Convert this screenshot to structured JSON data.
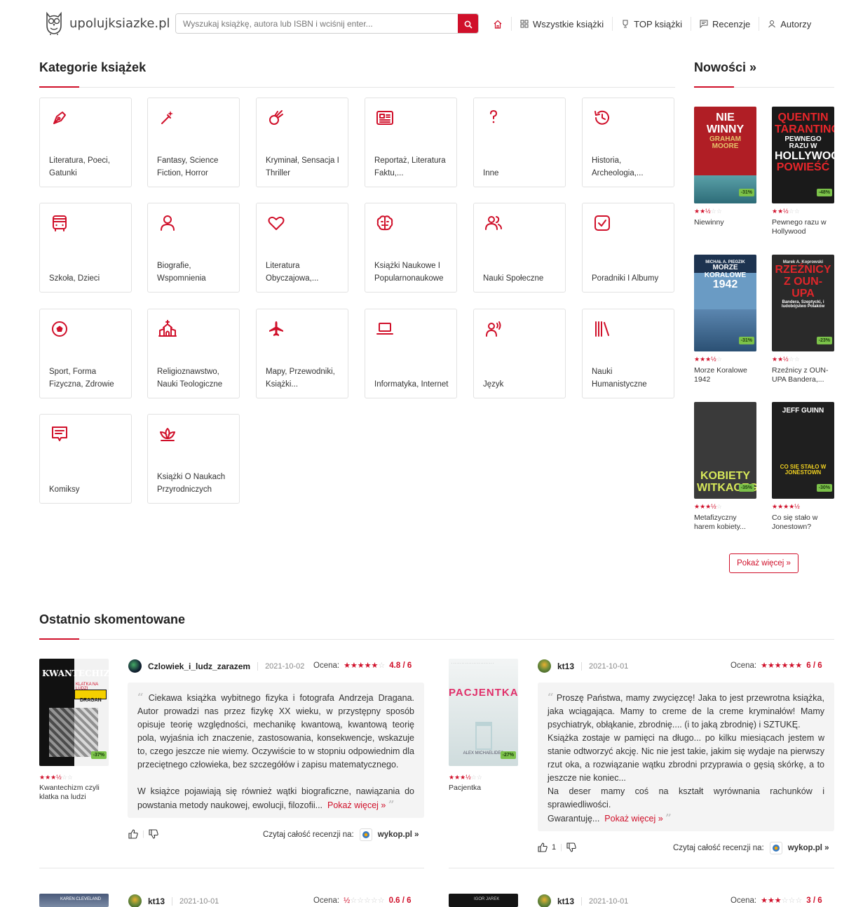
{
  "header": {
    "logo": "upolujksiazke.pl",
    "search_placeholder": "Wyszukaj książkę, autora lub ISBN i wciśnij enter...",
    "nav": [
      "Wszystkie książki",
      "TOP książki",
      "Recenzje",
      "Autorzy"
    ]
  },
  "categories_section": {
    "title": "Kategorie książek",
    "items": [
      {
        "label": "Literatura, Poeci, Gatunki",
        "icon": "pen-nib-icon"
      },
      {
        "label": "Fantasy, Science Fiction, Horror",
        "icon": "magic-wand-icon"
      },
      {
        "label": "Kryminał, Sensacja I Thriller",
        "icon": "comet-icon"
      },
      {
        "label": "Reportaż, Literatura Faktu,...",
        "icon": "newspaper-icon"
      },
      {
        "label": "Inne",
        "icon": "question-icon"
      },
      {
        "label": "Historia, Archeologia,...",
        "icon": "history-icon"
      },
      {
        "label": "Szkoła, Dzieci",
        "icon": "bus-icon"
      },
      {
        "label": "Biografie, Wspomnienia",
        "icon": "person-icon"
      },
      {
        "label": "Literatura Obyczajowa,...",
        "icon": "heart-icon"
      },
      {
        "label": "Książki Naukowe I Popularnonaukowe",
        "icon": "brain-icon"
      },
      {
        "label": "Nauki Społeczne",
        "icon": "people-icon"
      },
      {
        "label": "Poradniki I Albumy",
        "icon": "checkbox-icon"
      },
      {
        "label": "Sport, Forma Fizyczna, Zdrowie",
        "icon": "ball-icon"
      },
      {
        "label": "Religioznawstwo, Nauki Teologiczne",
        "icon": "church-icon"
      },
      {
        "label": "Mapy, Przewodniki, Książki...",
        "icon": "plane-icon"
      },
      {
        "label": "Informatyka, Internet",
        "icon": "laptop-icon"
      },
      {
        "label": "Język",
        "icon": "speaking-icon"
      },
      {
        "label": "Nauki Humanistyczne",
        "icon": "books-icon"
      },
      {
        "label": "Komiksy",
        "icon": "speech-bubble-icon"
      },
      {
        "label": "Książki O Naukach Przyrodniczych",
        "icon": "lotus-icon"
      }
    ]
  },
  "new_books": {
    "title": "Nowości »",
    "more": "Pokaż więcej »",
    "items": [
      {
        "title": "Niewinny",
        "discount": "-31%",
        "stars": 2,
        "cover_text": [
          "NIE",
          "WINNY",
          "GRAHAM MOORE"
        ],
        "color": "#b01e25"
      },
      {
        "title": "Pewnego razu w Hollywood",
        "discount": "-48%",
        "stars": 2,
        "cover_text": [
          "QUENTIN",
          "TARANTINO",
          "PEWNEGO RAZU W",
          "HOLLYWOOD",
          "POWIEŚĆ"
        ],
        "color": "#1a1a1a"
      },
      {
        "title": "Morze Koralowe 1942",
        "discount": "-31%",
        "stars": 3,
        "cover_text": [
          "MICHAŁ A. PIEGZIK",
          "MORZE KORALOWE",
          "1942"
        ],
        "color": "#6a9bc4"
      },
      {
        "title": "Rzeźnicy z OUN-UPA Bandera,...",
        "discount": "-23%",
        "stars": 2,
        "cover_text": [
          "Marek A. Koprowski",
          "RZEŹNICY",
          "Z OUN-UPA",
          "Bandera, Szeptycki, i ludobójstwo Polaków"
        ],
        "color": "#2a2a2a"
      },
      {
        "title": "Metafizyczny harem kobiety...",
        "discount": "-35%",
        "stars": 3,
        "cover_text": [
          "KOBIETY",
          "WITKACEGO"
        ],
        "color": "#3a3a3a"
      },
      {
        "title": "Co się stało w Jonestown?",
        "discount": "-30%",
        "stars": 4,
        "cover_text": [
          "JEFF GUINN",
          "CO SIĘ STAŁO W JONESTOWN"
        ],
        "color": "#1f1f1f"
      }
    ]
  },
  "reviews_section": {
    "title": "Ostatnio skomentowane",
    "rating_label": "Ocena:",
    "read_label": "Czytaj całość recenzji na:",
    "source": "wykop.pl »",
    "more_link": "Pokaż więcej »",
    "items": [
      {
        "book_title": "Kwantechizm czyli klatka na ludzi",
        "discount": "-37%",
        "book_stars": 3,
        "cover_text": [
          "KWANTECHIZM",
          "KLATKA NA LUDZI",
          "DRAGAN"
        ],
        "user": "Czlowiek_i_ludz_zarazem",
        "date": "2021-10-02",
        "rating": "4.8 / 6",
        "rating_stars": 5,
        "p1": "Ciekawa książka wybitnego fizyka i fotografa Andrzeja Dragana. Autor prowadzi nas przez fizykę XX wieku, w przystępny sposób opisuje teorię względności, mechanikę kwantową, kwantową teorię pola, wyjaśnia ich znaczenie, zastosowania, konsekwencje, wskazuje to, czego jeszcze nie wiemy. Oczywiście to w stopniu odpowiednim dla przeciętnego człowieka, bez szczegółów i zapisu matematycznego.",
        "p2": "W książce pojawiają się również wątki biograficzne, nawiązania do powstania metody naukowej, ewolucji, filozofii...",
        "likes": ""
      },
      {
        "book_title": "Pacjentka",
        "discount": "-27%",
        "book_stars": 3,
        "cover_text": [
          "PACJENTKA",
          "ALEX MICHAELIDES"
        ],
        "user": "kt13",
        "date": "2021-10-01",
        "rating": "6 / 6",
        "rating_stars": 6,
        "p1": "Proszę Państwa, mamy zwycięzcę! Jaka to jest przewrotna książka, jaka wciągająca. Mamy to creme de la creme kryminałów! Mamy psychiatryk, obłąkanie, zbrodnię.... (i to jaką zbrodnię) i SZTUKĘ.",
        "p2": "Książka zostaje w pamięci na długo... po kilku miesiącach jestem w stanie odtworzyć akcję. Nic nie jest takie, jakim się wydaje na pierwszy rzut oka, a rozwiązanie wątku zbrodni przyprawia o gęsią skórkę, a to jeszcze nie koniec...",
        "p3": "Na deser mamy coś na kształt wyrównania rachunków i sprawiedliwości.",
        "p4": "Gwarantuję...",
        "likes": "1"
      },
      {
        "user": "kt13",
        "date": "2021-10-01",
        "rating": "0.6 / 6",
        "rating_stars": 1,
        "cover_text": [
          "KAREN CLEVELAND"
        ]
      },
      {
        "user": "kt13",
        "date": "2021-10-01",
        "rating": "3 / 6",
        "rating_stars": 3,
        "cover_text": [
          "IGOR JAREK"
        ]
      }
    ]
  },
  "colors": {
    "accent": "#d0102a",
    "discount": "#7cc24a"
  }
}
